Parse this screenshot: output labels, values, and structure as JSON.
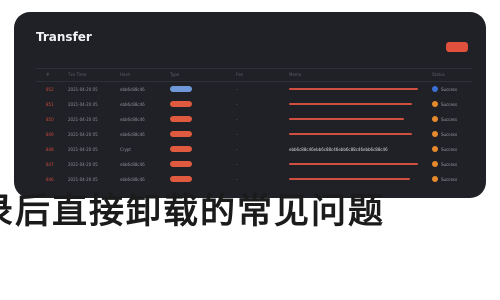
{
  "panel": {
    "title": "Transfer"
  },
  "table": {
    "header_marks": [
      "#",
      "Txn Time",
      "Hash",
      "Type",
      "Fee",
      "Memo",
      "Status"
    ],
    "rows": [
      {
        "id": "852",
        "time": "2021-04-20 05",
        "hash": "ebb6c88c46",
        "type_color": "#6f98d8",
        "note": "",
        "bar_len": 0.96,
        "status": "Success",
        "status_color": "#3b6fd4"
      },
      {
        "id": "851",
        "time": "2021-04-20 05",
        "hash": "ebb6c88c46",
        "type_color": "#e05a3f",
        "note": "",
        "bar_len": 0.92,
        "status": "Success",
        "status_color": "#e58a2d"
      },
      {
        "id": "850",
        "time": "2021-04-20 05",
        "hash": "ebb6c88c46",
        "type_color": "#e05a3f",
        "note": "",
        "bar_len": 0.86,
        "status": "Success",
        "status_color": "#e58a2d"
      },
      {
        "id": "849",
        "time": "2021-04-20 05",
        "hash": "ebb6c88c46",
        "type_color": "#e05a3f",
        "note": "",
        "bar_len": 0.92,
        "status": "Success",
        "status_color": "#e58a2d"
      },
      {
        "id": "848",
        "time": "2021-04-20 05",
        "hash": "Crypt",
        "type_color": "#e05a3f",
        "note": "ebb6c88c46ebb6c88c46ebb6c88c46ebb6c88c46",
        "bar_len": 0,
        "status": "Success",
        "status_color": "#e58a2d"
      },
      {
        "id": "847",
        "time": "2021-04-20 05",
        "hash": "ebb6c88c46",
        "type_color": "#e05a3f",
        "note": "",
        "bar_len": 0.96,
        "status": "Success",
        "status_color": "#e58a2d"
      },
      {
        "id": "846",
        "time": "2021-04-20 05",
        "hash": "ebb6c88c46",
        "type_color": "#e05a3f",
        "note": "",
        "bar_len": 0.9,
        "status": "Success",
        "status_color": "#e58a2d"
      }
    ]
  },
  "caption": {
    "text": "录后直接卸载的常见问题"
  },
  "colors": {
    "panel_bg": "#1f2126",
    "accent": "#e0503d",
    "caption": "#1b1b1b"
  }
}
